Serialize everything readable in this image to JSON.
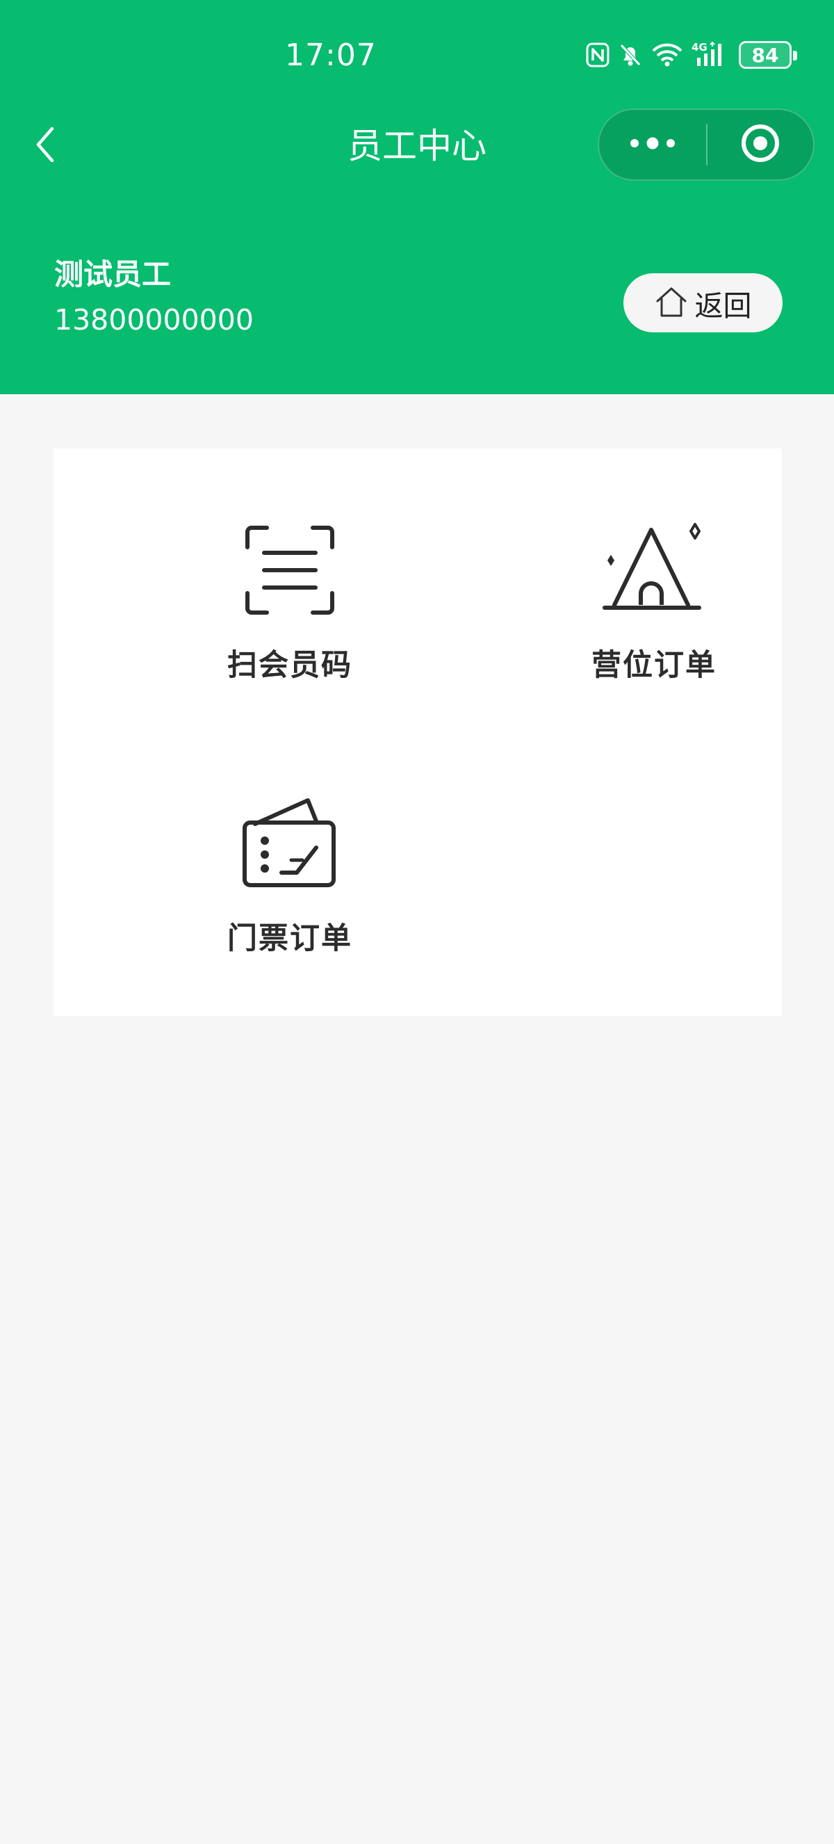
{
  "status_bar": {
    "time": "17:07",
    "battery": "84",
    "icons": [
      "nfc-icon",
      "bell-muted-icon",
      "wifi-icon",
      "cellular-4g-icon",
      "battery-icon"
    ]
  },
  "nav": {
    "title": "员工中心",
    "back_icon": "chevron-left-icon",
    "more_icon": "more-dots-icon",
    "close_icon": "target-circle-icon"
  },
  "user": {
    "name": "测试员工",
    "phone": "13800000000"
  },
  "back_button": {
    "label": "返回",
    "icon": "home-icon"
  },
  "menu": {
    "items": [
      {
        "label": "扫会员码",
        "icon": "scan-code-icon"
      },
      {
        "label": "营位订单",
        "icon": "tent-icon"
      },
      {
        "label": "门票订单",
        "icon": "ticket-icon"
      }
    ]
  },
  "colors": {
    "brand_green": "#07bb6f",
    "capsule_green": "#06a15f",
    "page_bg": "#f6f6f6",
    "card_bg": "#ffffff",
    "text_dark": "#2c2c2c",
    "text_white": "#ffffff"
  }
}
